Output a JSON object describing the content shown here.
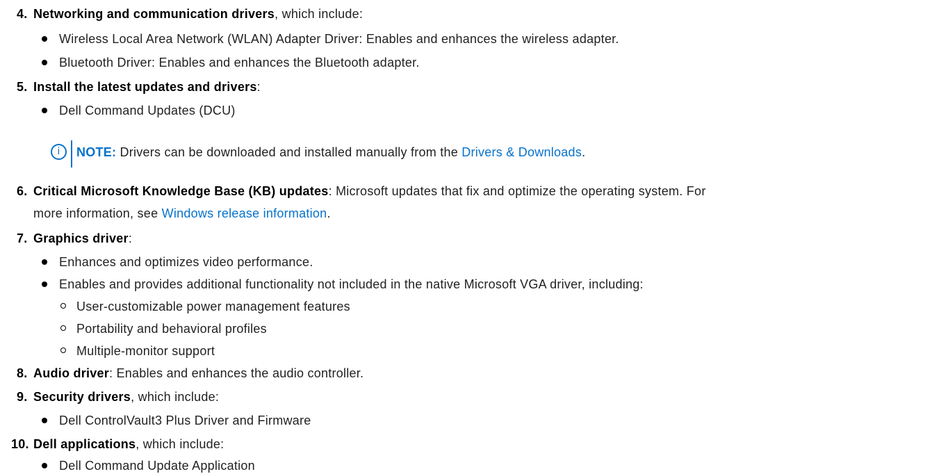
{
  "items": {
    "i4": {
      "num": "4.",
      "title": "Networking and communication drivers",
      "rest": ", which include:",
      "bullets": [
        "Wireless Local Area Network (WLAN) Adapter Driver: Enables and enhances the wireless adapter.",
        "Bluetooth Driver: Enables and enhances the Bluetooth adapter."
      ]
    },
    "i5": {
      "num": "5.",
      "title": "Install the latest updates and drivers",
      "rest": ":",
      "bullets": [
        "Dell Command Updates (DCU)"
      ],
      "note": {
        "icon": "info-icon",
        "label": "NOTE:",
        "text": " Drivers can be downloaded and installed manually from the ",
        "link": "Drivers & Downloads",
        "end": "."
      }
    },
    "i6": {
      "num": "6.",
      "title": "Critical Microsoft Knowledge Base (KB) updates",
      "rest": ": Microsoft updates that fix and optimize the operating system. For",
      "line2_pre": "more information, see ",
      "link": "Windows release information",
      "line2_end": "."
    },
    "i7": {
      "num": "7.",
      "title": "Graphics driver",
      "rest": ":",
      "bullets": [
        "Enhances and optimizes video performance.",
        "Enables and provides additional functionality not included in the native Microsoft VGA driver, including:"
      ],
      "sub_bullets": [
        "User-customizable power management features",
        "Portability and behavioral profiles",
        "Multiple-monitor support"
      ]
    },
    "i8": {
      "num": "8.",
      "title": "Audio driver",
      "rest": ": Enables and enhances the audio controller."
    },
    "i9": {
      "num": "9.",
      "title": "Security drivers",
      "rest": ", which include:",
      "bullets": [
        "Dell ControlVault3 Plus Driver and Firmware"
      ]
    },
    "i10": {
      "num": "10.",
      "title": "Dell applications",
      "rest": ", which include:",
      "bullets": [
        "Dell Command Update Application"
      ]
    }
  },
  "colors": {
    "link": "#0672cb",
    "text": "#222222",
    "note_accent": "#0672cb"
  }
}
